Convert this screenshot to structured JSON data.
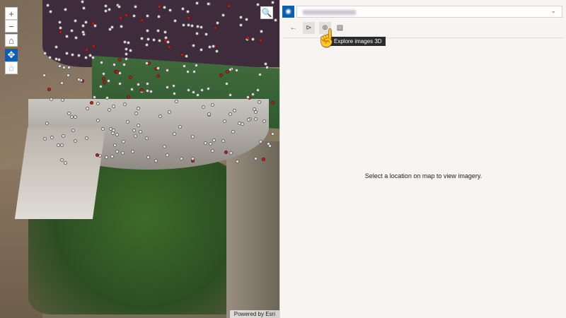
{
  "map": {
    "zoom_in": "+",
    "zoom_out": "−",
    "attribution": "Powered by Esri"
  },
  "panel": {
    "tooltip": "Explore images 3D",
    "empty_message": "Select a location on map to view imagery.",
    "back": "←"
  },
  "colors": {
    "accent": "#0a5fb4",
    "tooltip_bg": "#2b2b2b"
  }
}
